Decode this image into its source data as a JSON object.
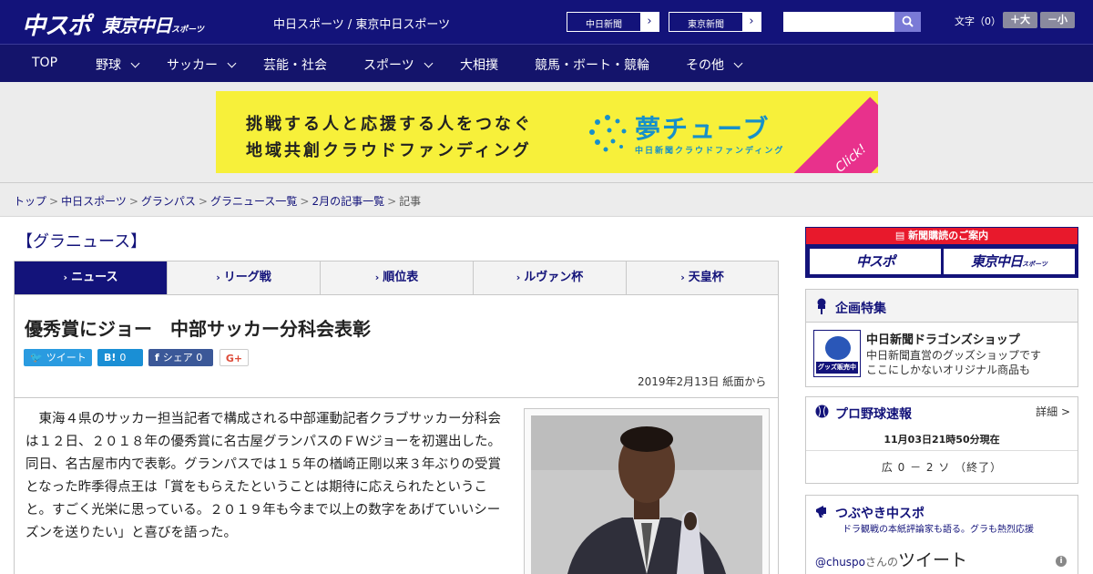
{
  "header": {
    "logo_main": "中スポ",
    "logo_sub": "東京中日",
    "logo_sub_small": "スポーツ",
    "site_name": "中日スポーツ / 東京中日スポーツ",
    "ext_links": [
      {
        "label": "中日新聞",
        "arrow": "›"
      },
      {
        "label": "東京新聞",
        "arrow": "›"
      }
    ],
    "search_placeholder": "",
    "font_size_label": "文字（0）",
    "font_bigger": "＋大",
    "font_smaller": "－小"
  },
  "nav": [
    {
      "label": "TOP",
      "has_menu": false
    },
    {
      "label": "野球",
      "has_menu": true
    },
    {
      "label": "サッカー",
      "has_menu": true
    },
    {
      "label": "芸能・社会",
      "has_menu": false
    },
    {
      "label": "スポーツ",
      "has_menu": true
    },
    {
      "label": "大相撲",
      "has_menu": false
    },
    {
      "label": "競馬・ボート・競輪",
      "has_menu": false
    },
    {
      "label": "その他",
      "has_menu": true
    }
  ],
  "ad": {
    "line1": "挑戦する人と応援する人をつなぐ",
    "line2": "地域共創クラウドファンディング",
    "brand": "夢チューブ",
    "brand_sub": "中日新聞クラウドファンディング",
    "cta": "Click!",
    "colors": {
      "background": "#f7f03a",
      "brand": "#1790c9",
      "cta": "#e8318c"
    }
  },
  "breadcrumb": {
    "items": [
      "トップ",
      "中日スポーツ",
      "グランパス",
      "グラニュース一覧",
      "2月の記事一覧"
    ],
    "current": "記事",
    "separator": ">"
  },
  "section_title": "【グラニュース】",
  "tabs": [
    {
      "label": "ニュース",
      "active": true
    },
    {
      "label": "リーグ戦",
      "active": false
    },
    {
      "label": "順位表",
      "active": false
    },
    {
      "label": "ルヴァン杯",
      "active": false
    },
    {
      "label": "天皇杯",
      "active": false
    }
  ],
  "tab_arrow": "›",
  "article": {
    "headline": "優秀賞にジョー　中部サッカー分科会表彰",
    "share": {
      "tweet": "ツイート",
      "hatena": "B!",
      "hatena_count": "0",
      "facebook": "シェア",
      "facebook_count": "0",
      "gplus": "G+"
    },
    "date": "2019年2月13日 紙面から",
    "body": "　東海４県のサッカー担当記者で構成される中部運動記者クラブサッカー分科会は１２日、２０１８年の優秀賞に名古屋グランパスのＦＷジョーを初選出した。同日、名古屋市内で表彰。グランパスでは１５年の楢崎正剛以来３年ぶりの受賞となった昨季得点王は「賞をもらえたということは期待に応えられたということ。すごく光栄に思っている。２０１９年も今まで以上の数字をあげていいシーズンを送りたい」と喜びを語った。"
  },
  "sidebar": {
    "subscribe": {
      "head": "新聞購読のご案内",
      "btn1": "中スポ",
      "btn2": "東京中日",
      "btn2_small": "スポーツ"
    },
    "feature": {
      "title": "企画特集",
      "shop_title": "中日新聞ドラゴンズショップ",
      "shop_desc1": "中日新聞直営のグッズショップです",
      "shop_desc2": "ここにしかないオリジナル商品も",
      "thumb_label": "グッズ販売中"
    },
    "baseball": {
      "title": "プロ野球速報",
      "more": "詳細 >",
      "time": "11月03日21時50分現在",
      "score": "広 0 － 2 ソ （終了）"
    },
    "tweets": {
      "title": "つぶやき中スポ",
      "subtitle": "ドラ観戦の本紙評論家も語る。グラも熱烈応援",
      "handle": "@chuspo",
      "handle_suffix": "さんの",
      "tweets_label": "ツイート"
    }
  },
  "colors": {
    "brand_navy": "#13137a",
    "accent_red": "#e8192c"
  }
}
